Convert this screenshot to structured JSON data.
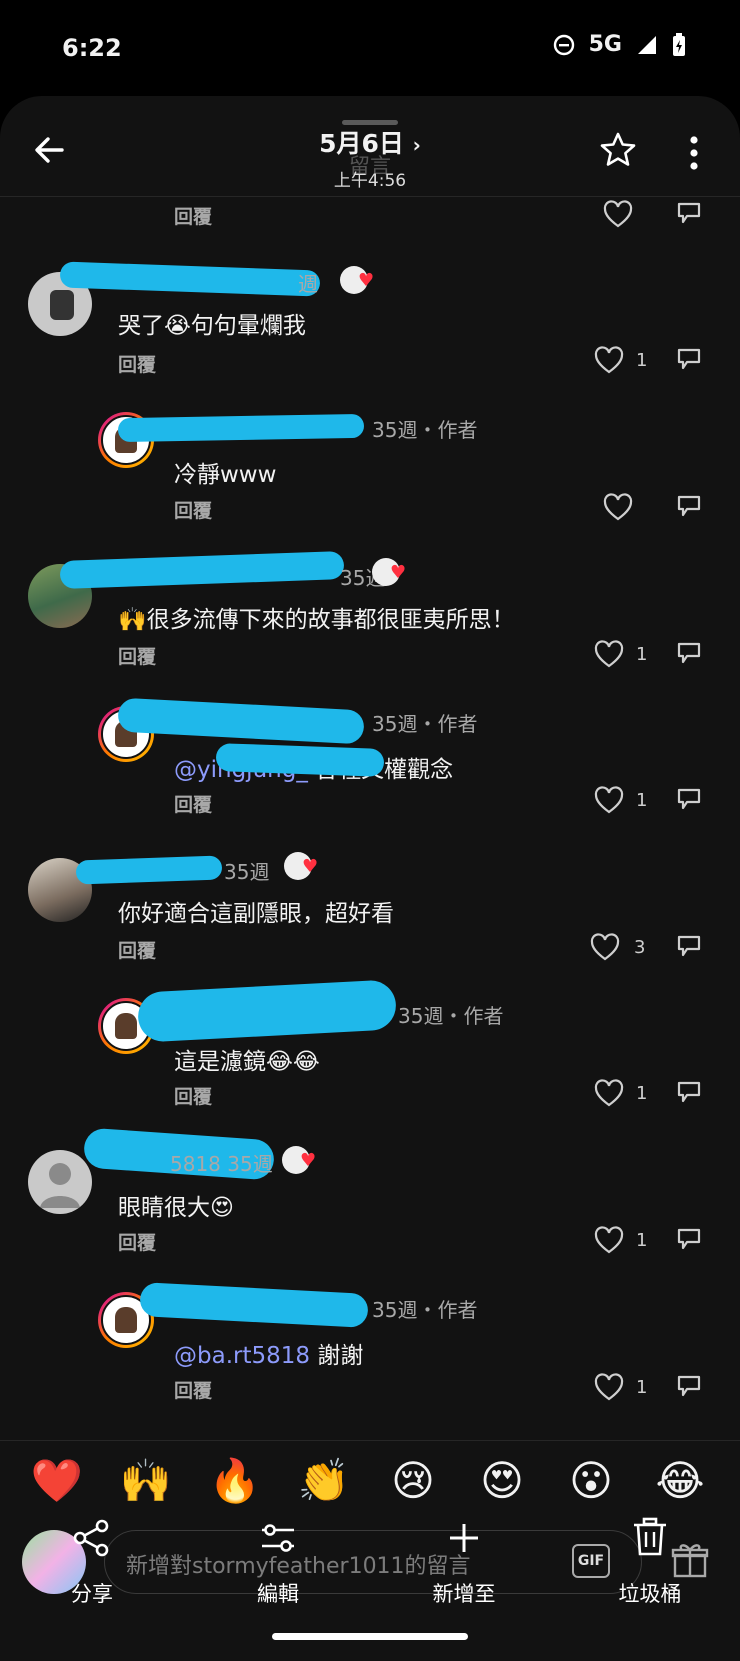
{
  "status": {
    "time": "6:22",
    "network": "5G"
  },
  "header": {
    "title": "5月6日",
    "subtitle": "上午4:56",
    "overlay_title": "留言"
  },
  "comments": [
    {
      "reply_label": "回覆"
    },
    {
      "name_visible": "週",
      "text": "哭了😭句句暈爛我",
      "reply_label": "回覆",
      "likes": "1"
    },
    {
      "name_visible": "35週・作者",
      "text": "冷靜www",
      "reply_label": "回覆",
      "likes": ""
    },
    {
      "name_visible": "35週",
      "text": "🙌很多流傳下來的故事都很匪夷所思！",
      "reply_label": "回覆",
      "likes": "1"
    },
    {
      "name_visible": "35週・作者",
      "mention": "@yingjung_",
      "text": " 各種父權觀念",
      "reply_label": "回覆",
      "likes": "1"
    },
    {
      "name_visible": "35週",
      "text": "你好適合這副隱眼，超好看",
      "reply_label": "回覆",
      "likes": "3"
    },
    {
      "name_visible": "35週・作者",
      "text": "這是濾鏡😂😂",
      "reply_label": "回覆",
      "likes": "1"
    },
    {
      "name_visible": "5818 35週",
      "text": "眼睛很大😍",
      "reply_label": "回覆",
      "likes": "1"
    },
    {
      "name_visible": "35週・作者",
      "mention": "@ba.rt5818",
      "text": " 謝謝",
      "reply_label": "回覆",
      "likes": "1"
    }
  ],
  "emoji_bar": [
    "❤️",
    "🙌",
    "🔥",
    "👏",
    "😢",
    "😍",
    "😮",
    "😂"
  ],
  "input": {
    "placeholder": "新增對stormyfeather1011的留言",
    "gif_label": "GIF"
  },
  "actions": {
    "share": "分享",
    "edit": "編輯",
    "add_to": "新增至",
    "trash": "垃圾桶"
  },
  "colors": {
    "background": "#121212",
    "mention": "#8d9bfb",
    "redaction": "#1fb8ea",
    "like_heart": "#ff3040"
  }
}
